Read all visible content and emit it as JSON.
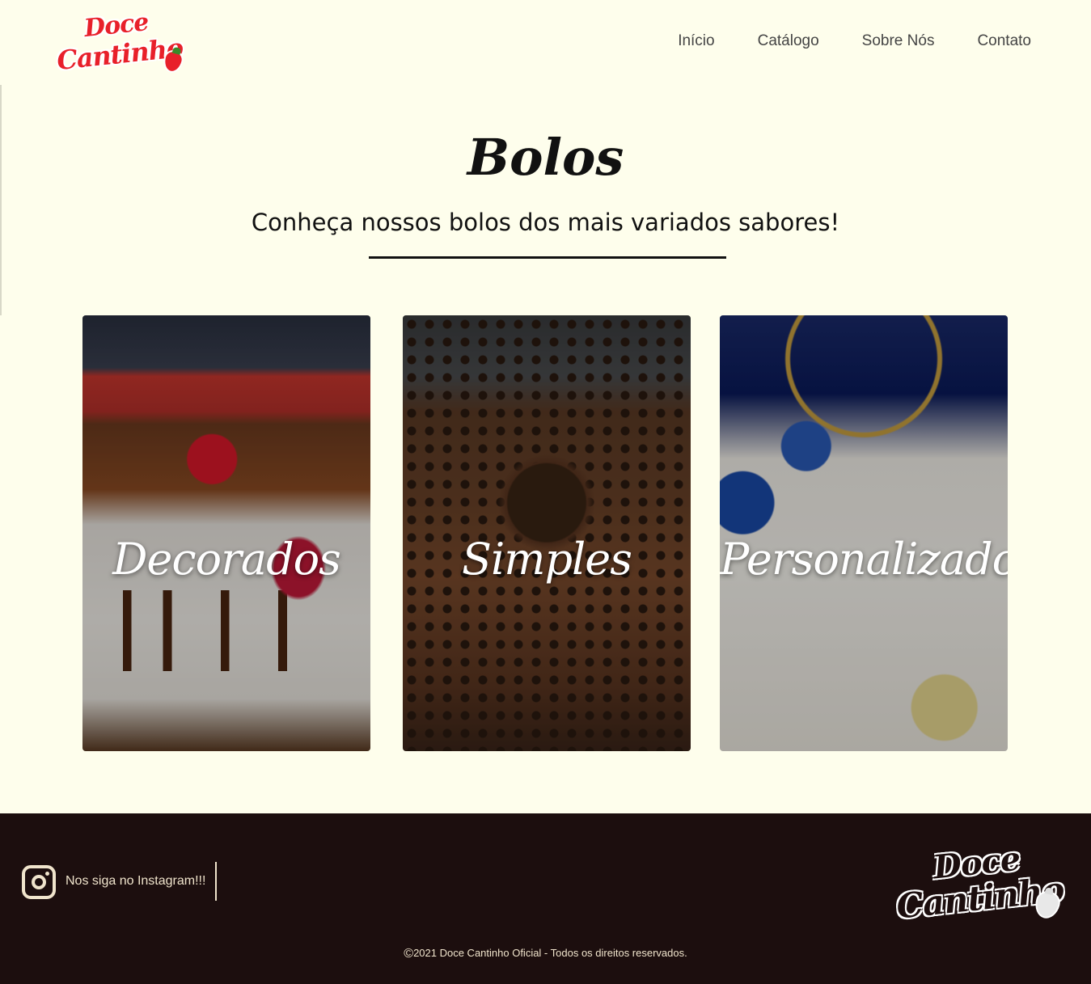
{
  "brand": {
    "logo_line1": "Doce",
    "logo_line2": "Cantinho"
  },
  "nav": [
    {
      "label": "Início"
    },
    {
      "label": "Catálogo"
    },
    {
      "label": "Sobre Nós"
    },
    {
      "label": "Contato"
    }
  ],
  "hero": {
    "title": "Bolos",
    "subtitle": "Conheça nossos bolos dos mais variados sabores!"
  },
  "categories": [
    {
      "label": "Decorados"
    },
    {
      "label": "Simples"
    },
    {
      "label": "Personalizados"
    }
  ],
  "footer": {
    "instagram_text": "Nos siga no Instagram!!!",
    "copyright_symbol": "©",
    "copyright_text": "2021 Doce Cantinho Oficial - Todos os direitos reservados."
  },
  "colors": {
    "background": "#fefeec",
    "footer_background": "#1c0e0e",
    "brand_red": "#e8202a",
    "footer_text": "#f0e4cc"
  },
  "icons": {
    "social": "instagram-icon",
    "logo_mark": "strawberry-icon"
  }
}
